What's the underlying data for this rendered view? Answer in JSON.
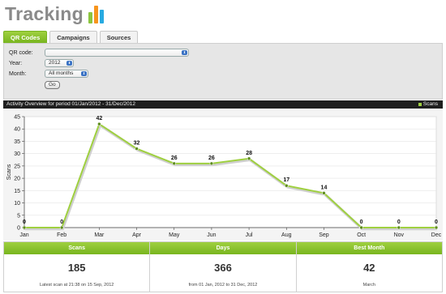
{
  "header": {
    "title": "Tracking",
    "logo_colors": [
      "#8cc63f",
      "#f7941d",
      "#27aae1"
    ]
  },
  "tabs": [
    {
      "label": "QR Codes",
      "active": true
    },
    {
      "label": "Campaigns",
      "active": false
    },
    {
      "label": "Sources",
      "active": false
    }
  ],
  "filters": {
    "qr_label": "QR code:",
    "qr_value": "",
    "year_label": "Year:",
    "year_value": "2012",
    "month_label": "Month:",
    "month_value": "All months",
    "go_label": "Go"
  },
  "chart_header": {
    "title": "Activity Overview for period 01/Jan/2012 - 31/Dec/2012",
    "legend": "Scans"
  },
  "chart_data": {
    "type": "line",
    "title": "",
    "ylabel": "Scans",
    "xlabel": "",
    "categories": [
      "Jan",
      "Feb",
      "Mar",
      "Apr",
      "May",
      "Jun",
      "Jul",
      "Aug",
      "Sep",
      "Oct",
      "Nov",
      "Dec"
    ],
    "series": [
      {
        "name": "Scans",
        "values": [
          0,
          0,
          42,
          32,
          26,
          26,
          28,
          17,
          14,
          0,
          0,
          0
        ]
      }
    ],
    "ylim": [
      0,
      45
    ],
    "yticks": [
      0,
      5,
      10,
      15,
      20,
      25,
      30,
      35,
      40,
      45
    ],
    "grid": true,
    "color": "#9fd040",
    "legend": "top-right"
  },
  "stats": [
    {
      "header": "Scans",
      "value": "185",
      "sub": "Latest scan at 21:38 on 15 Sep, 2012"
    },
    {
      "header": "Days",
      "value": "366",
      "sub": "from 01 Jan, 2012 to 31 Dec, 2012"
    },
    {
      "header": "Best Month",
      "value": "42",
      "sub": "March"
    }
  ]
}
